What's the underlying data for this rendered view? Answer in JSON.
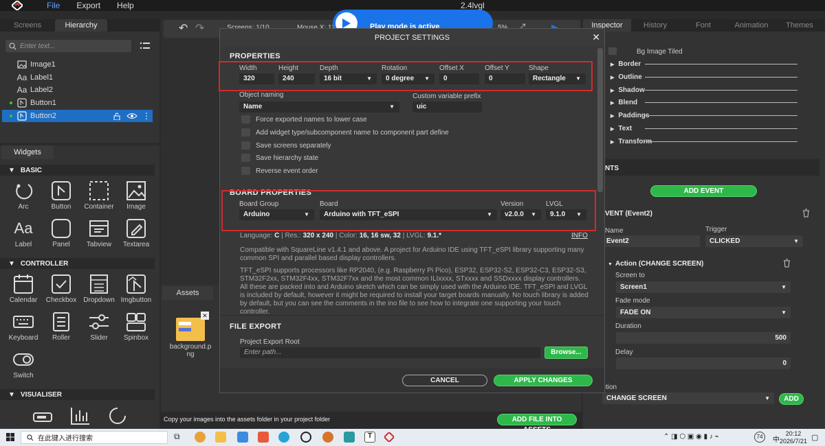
{
  "app": {
    "title": "2.4lvgl",
    "menu": [
      "File",
      "Export",
      "Help"
    ]
  },
  "hierarchy": {
    "tabs": [
      "Screens",
      "Hierarchy"
    ],
    "search_placeholder": "Enter text...",
    "items": [
      {
        "label": "Image1",
        "icon": "image-icon"
      },
      {
        "label": "Label1",
        "icon": "label-icon"
      },
      {
        "label": "Label2",
        "icon": "label-icon"
      },
      {
        "label": "Button1",
        "icon": "button-icon"
      },
      {
        "label": "Button2",
        "icon": "button-icon"
      }
    ]
  },
  "widgets": {
    "tab": "Widgets",
    "sections": {
      "basic": "BASIC",
      "controller": "CONTROLLER",
      "visualiser": "VISUALISER"
    },
    "basic": [
      "Arc",
      "Button",
      "Container",
      "Image",
      "Label",
      "Panel",
      "Tabview",
      "Textarea"
    ],
    "controller": [
      "Calendar",
      "Checkbox",
      "Dropdown",
      "Imgbutton",
      "Keyboard",
      "Roller",
      "Slider",
      "Spinbox",
      "Switch"
    ]
  },
  "center": {
    "screens_label": "Screens: 1/10",
    "mouse_label": "Mouse X: 11",
    "zoom_label": "5%"
  },
  "play_toast": "Play mode is active",
  "assets": {
    "tab": "Assets",
    "file": "background.p\nng",
    "footer_text": "Copy your images into the assets folder in your project folder",
    "add_button": "ADD FILE INTO ASSETS"
  },
  "inspector": {
    "tabs": [
      "Inspector",
      "History",
      "Font",
      "Animation",
      "Themes"
    ],
    "bg_image_tiled": "Bg Image Tiled",
    "groups": [
      "Border",
      "Outline",
      "Shadow",
      "Blend",
      "Paddings",
      "Text",
      "Transform"
    ],
    "events_header": "NTS",
    "add_event": "ADD EVENT",
    "event_title": "VENT (Event2)",
    "name_label": "Name",
    "name_value": "Event2",
    "trigger_label": "Trigger",
    "trigger_value": "CLICKED",
    "action_title": "Action (CHANGE SCREEN)",
    "screen_to_label": "Screen to",
    "screen_to_value": "Screen1",
    "fade_mode_label": "Fade mode",
    "fade_mode_value": "FADE ON",
    "duration_label": "Duration",
    "duration_value": "500",
    "delay_label": "Delay",
    "delay_value": "0",
    "action_label": "ction",
    "action_value": "CHANGE SCREEN",
    "add_label": "ADD"
  },
  "modal": {
    "title": "PROJECT SETTINGS",
    "properties_header": "PROPERTIES",
    "fields": {
      "width_label": "Width",
      "width": "320",
      "height_label": "Height",
      "height": "240",
      "depth_label": "Depth",
      "depth": "16 bit",
      "rotation_label": "Rotation",
      "rotation": "0 degree",
      "offx_label": "Offset X",
      "offx": "0",
      "offy_label": "Offset Y",
      "offy": "0",
      "shape_label": "Shape",
      "shape": "Rectangle"
    },
    "object_naming_label": "Object naming",
    "object_naming": "Name",
    "prefix_label": "Custom variable prefix",
    "prefix": "uic",
    "checkboxes": [
      "Force exported names to lower case",
      "Add widget type/subcomponent name to component part define",
      "Save screens separately",
      "Save hierarchy state",
      "Reverse event order"
    ],
    "board_header": "BOARD PROPERTIES",
    "board_group_label": "Board Group",
    "board_group": "Arduino",
    "board_label": "Board",
    "board": "Arduino with TFT_eSPI",
    "version_label": "Version",
    "version": "v2.0.0",
    "lvgl_label": "LVGL",
    "lvgl": "9.1.0",
    "info_line": {
      "lang_label": "Language: ",
      "lang": "C",
      "res_label": " | Res.: ",
      "res": "320 x 240",
      "color_label": " | Color: ",
      "color": "16, 16 sw, 32",
      "lvgl_label": " | LVGL: ",
      "lvgl": "9.1.*"
    },
    "info_link": "INFO",
    "desc1": "Compatible with SquareLine v1.4.1 and above. A project for Arduino IDE using TFT_eSPI library supporting many common SPI and parallel based display controllers.",
    "desc2": "TFT_eSPI supports processors like RP2040, (e.g. Raspberry Pi Pico), ESP32, ESP32-S2, ESP32-C3, ESP32-S3, STM32F2xx, STM32F4xx, STM32F7xx and the most common ILIxxxx, STxxxx and SSDxxxx display controllers. All these are packed into and Arduino sketch which can be simply used with the Arduino IDE. TFT_eSPI and LVGL is included by default, however it might be required to install your target boards manually.  No touch library is added by default, but you can see the comments in the ino file to see how to integrate one supporting your touch controller.",
    "file_export_header": "FILE EXPORT",
    "export_root_label": "Project Export Root",
    "export_placeholder": "Enter path...",
    "browse": "Browse...",
    "cancel": "CANCEL",
    "apply": "APPLY CHANGES"
  },
  "taskbar": {
    "search": "在此键入进行搜索",
    "temp": "74",
    "time": "20:12",
    "date": "2026/7/21"
  },
  "colors": {
    "accent": "#1e6fc4",
    "green": "#2fb84a",
    "red": "#d42a2a"
  }
}
